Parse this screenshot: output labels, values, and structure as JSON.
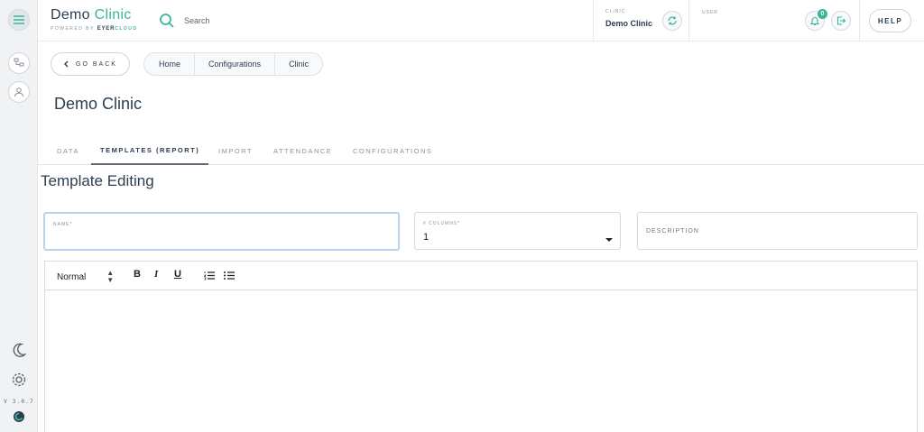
{
  "app": {
    "brand_primary": "Demo",
    "brand_accent": "Clinic",
    "powered_prefix": "POWERED BY",
    "powered_brand_a": "Eyer",
    "powered_brand_b": "Cloud",
    "version": "V 3.0.7"
  },
  "header": {
    "search_placeholder": "Search",
    "clinic_label": "CLINIC",
    "clinic_name": "Demo Clinic",
    "user_label": "USER",
    "notifications_count": "0",
    "help_label": "HELP"
  },
  "nav": {
    "go_back_label": "GO BACK",
    "breadcrumbs": [
      "Home",
      "Configurations",
      "Clinic"
    ]
  },
  "page": {
    "title": "Demo Clinic",
    "tabs": [
      {
        "label": "DATA",
        "active": false
      },
      {
        "label": "TEMPLATES (REPORT)",
        "active": true
      },
      {
        "label": "IMPORT",
        "active": false
      },
      {
        "label": "ATTENDANCE",
        "active": false
      },
      {
        "label": "CONFIGURATIONS",
        "active": false
      }
    ],
    "section_title": "Template Editing"
  },
  "form": {
    "name_label": "NAME*",
    "name_value": "",
    "columns_label": "# COLUMNS*",
    "columns_value": "1",
    "description_placeholder": "DESCRIPTION"
  },
  "editor": {
    "format_select": "Normal",
    "bold": "B",
    "italic": "I",
    "underline": "U"
  },
  "colors": {
    "accent": "#3ab59c",
    "text_dark": "#2c3e50",
    "focus_border": "#b9d3ec"
  },
  "icons": [
    "menu-icon",
    "tree-icon",
    "user-icon",
    "moon-icon",
    "gear-icon",
    "search-icon",
    "sync-icon",
    "bell-icon",
    "logout-icon",
    "chevron-left-icon",
    "ordered-list-icon",
    "bullet-list-icon"
  ]
}
